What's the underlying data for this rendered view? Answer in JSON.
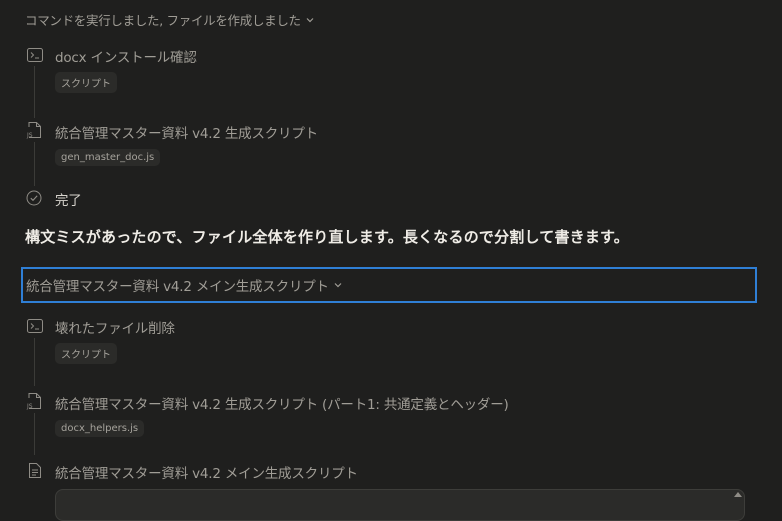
{
  "header": {
    "title": "コマンドを実行しました, ファイルを作成しました"
  },
  "steps_top": [
    {
      "label": "docx インストール確認",
      "chip": "スクリプト",
      "icon": "terminal-icon"
    },
    {
      "label": "統合管理マスター資料 v4.2 生成スクリプト",
      "chip": "gen_master_doc.js",
      "icon": "js-file-icon"
    },
    {
      "label": "完了",
      "icon": "check-circle-icon"
    }
  ],
  "message": "構文ミスがあったので、ファイル全体を作り直します。長くなるので分割して書きます。",
  "group2": {
    "title": "統合管理マスター資料 v4.2 メイン生成スクリプト"
  },
  "steps_bottom": [
    {
      "label": "壊れたファイル削除",
      "chip": "スクリプト",
      "icon": "terminal-icon"
    },
    {
      "label": "統合管理マスター資料 v4.2 生成スクリプト (パート1: 共通定義とヘッダー)",
      "chip": "docx_helpers.js",
      "icon": "js-file-icon"
    },
    {
      "label": "統合管理マスター資料 v4.2 メイン生成スクリプト",
      "icon": "document-icon"
    }
  ],
  "colors": {
    "background": "#1f1f1e",
    "accent": "#2f7fd6",
    "chip_bg": "#2b2b29"
  }
}
